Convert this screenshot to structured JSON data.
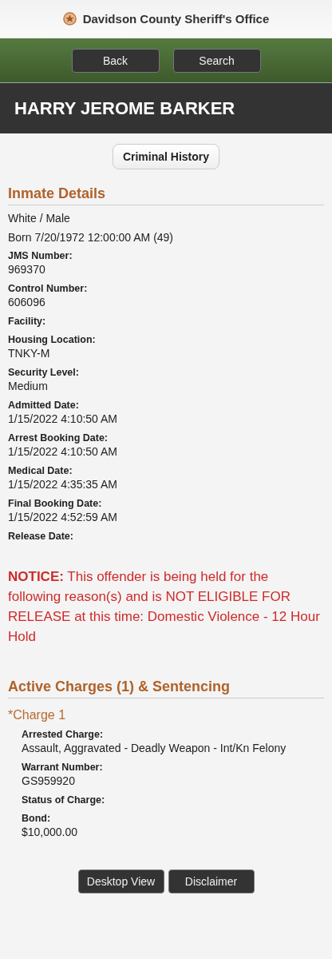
{
  "header": {
    "title": "Davidson County Sheriff's Office"
  },
  "nav_buttons": [
    "Back",
    "Search"
  ],
  "inmate_name": "HARRY JEROME BARKER",
  "history_button": "Criminal History",
  "inmate_details": {
    "heading": "Inmate Details",
    "summary": [
      "White / Male",
      "Born 7/20/1972 12:00:00 AM (49)"
    ],
    "fields": [
      {
        "label": "JMS Number:",
        "value": "969370"
      },
      {
        "label": "Control Number:",
        "value": "606096"
      },
      {
        "label": "Facility:"
      },
      {
        "label": "Housing Location:",
        "value": "TNKY-M"
      },
      {
        "label": "Security Level:",
        "value": "Medium"
      },
      {
        "label": "Admitted Date:",
        "value": "1/15/2022 4:10:50 AM"
      },
      {
        "label": "Arrest Booking Date:",
        "value": "1/15/2022 4:10:50 AM"
      },
      {
        "label": "Medical Date:",
        "value": "1/15/2022 4:35:35 AM"
      },
      {
        "label": "Final Booking Date:",
        "value": "1/15/2022 4:52:59 AM"
      },
      {
        "label": "Release Date:"
      }
    ]
  },
  "notice": "**NOTICE:** This offender is being held for the following reason(s) and is NOT ELIGIBLE FOR RELEASE at this time: Domestic Violence - 12 Hour Hold",
  "charges": {
    "heading": "Active Charges (1) & Sentencing",
    "items": [
      {
        "title": "*Charge 1",
        "fields": [
          {
            "label": "Arrested Charge:",
            "value": "Assault, Aggravated - Deadly Weapon - Int/Kn Felony"
          },
          {
            "label": "Warrant Number:",
            "value": "GS959920"
          },
          {
            "label": "Status of Charge:"
          },
          {
            "label": "Bond:",
            "value": "$10,000.00"
          }
        ]
      }
    ]
  },
  "footer_buttons": [
    "Desktop View",
    "Disclaimer"
  ]
}
